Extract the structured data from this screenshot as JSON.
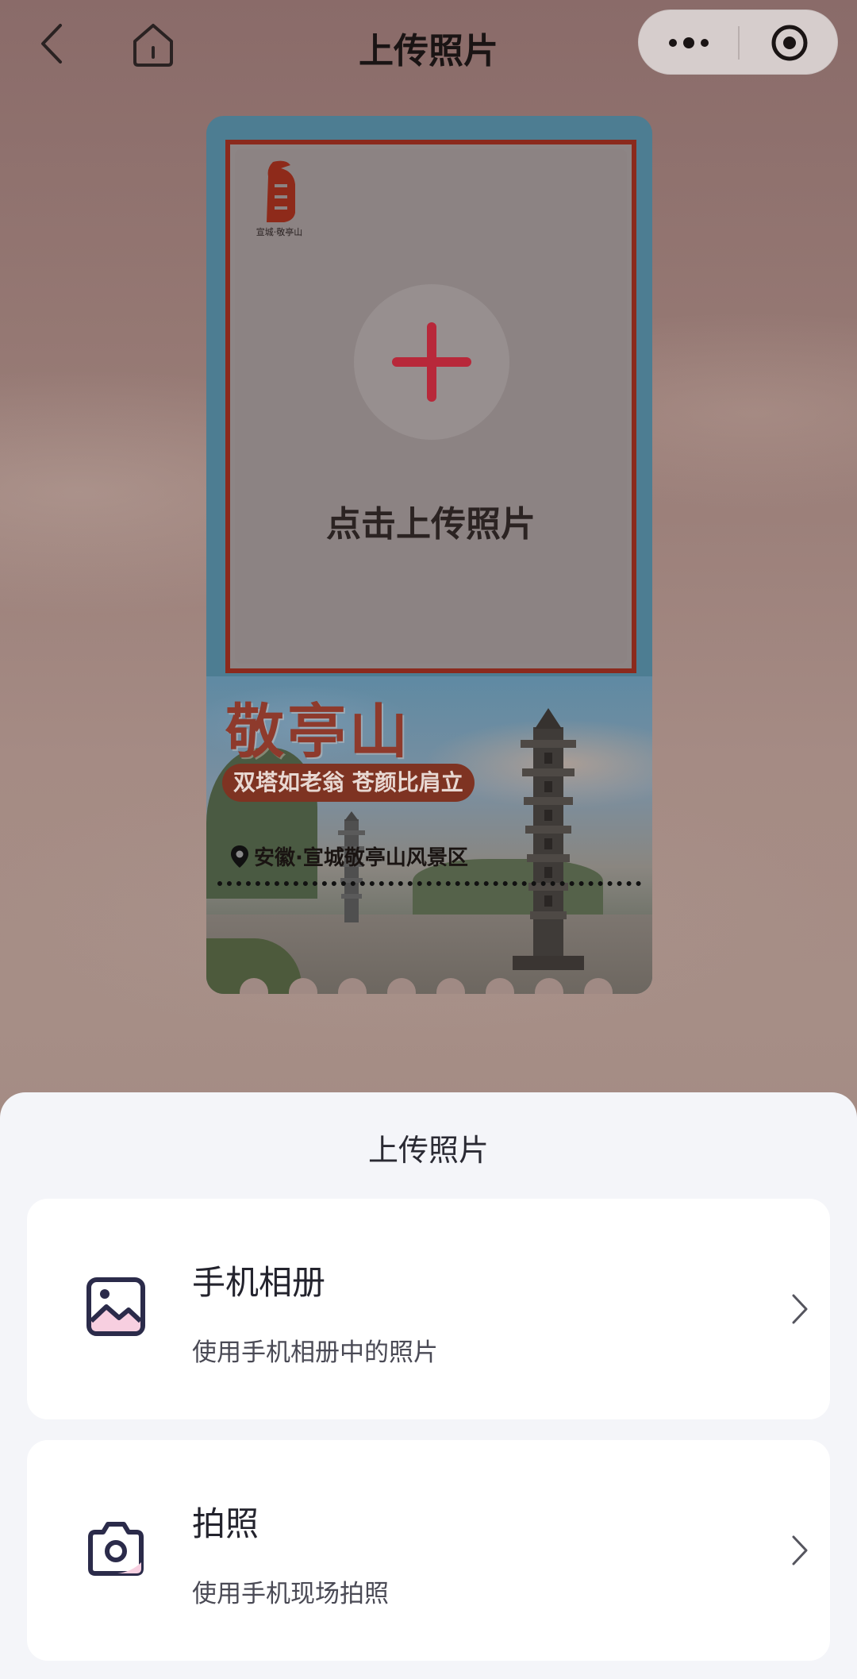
{
  "nav": {
    "title": "上传照片",
    "back_icon": "back-chevron-icon",
    "home_icon": "home-icon",
    "more_icon": "more-dots-icon",
    "close_icon": "target-circle-icon"
  },
  "card": {
    "logo_caption": "宣城·敬亭山",
    "upload_prompt": "点击上传照片",
    "scenic_name": "敬亭山",
    "slogan": "双塔如老翁 苍颜比肩立",
    "location": "安徽·宣城敬亭山风景区"
  },
  "sheet": {
    "title": "上传照片",
    "options": [
      {
        "title": "手机相册",
        "subtitle": "使用手机相册中的照片",
        "icon": "photo-album-icon"
      },
      {
        "title": "拍照",
        "subtitle": "使用手机现场拍照",
        "icon": "camera-icon"
      }
    ]
  },
  "colors": {
    "accent_red": "#c0283a",
    "frame_red": "#8b2a1d",
    "icon_navy": "#2b2b4a",
    "icon_pink": "#f7cfe0"
  }
}
